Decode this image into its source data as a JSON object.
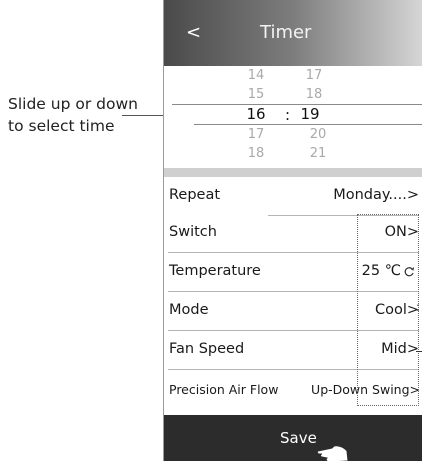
{
  "annotation": {
    "line1": "Slide up or down",
    "line2": "to select time"
  },
  "header": {
    "back": "<",
    "title": "Timer"
  },
  "picker": {
    "hours": [
      "14",
      "15",
      "16",
      "17",
      "18"
    ],
    "minutes": [
      "17",
      "18",
      "19",
      "20",
      "21"
    ],
    "separator": ":"
  },
  "settings": [
    {
      "label": "Repeat",
      "value": "Monday....>"
    },
    {
      "label": "Switch",
      "value": "ON>"
    },
    {
      "label": "Temperature",
      "value": "25 ℃"
    },
    {
      "label": "Mode",
      "value": "Cool>"
    },
    {
      "label": "Fan Speed",
      "value": "Mid>"
    },
    {
      "label": "Precision Air Flow",
      "value": "Up-Down Swing>"
    }
  ],
  "footer": {
    "save": "Save"
  },
  "icons": {
    "back": "chevron-left-icon",
    "temperature_sync": "sync-icon",
    "pointer": "hand-pointer-icon"
  },
  "colors": {
    "title_bar_dark": "#4a4a4a",
    "save_bar": "#2c2c2c",
    "band": "#cfcfcf"
  }
}
